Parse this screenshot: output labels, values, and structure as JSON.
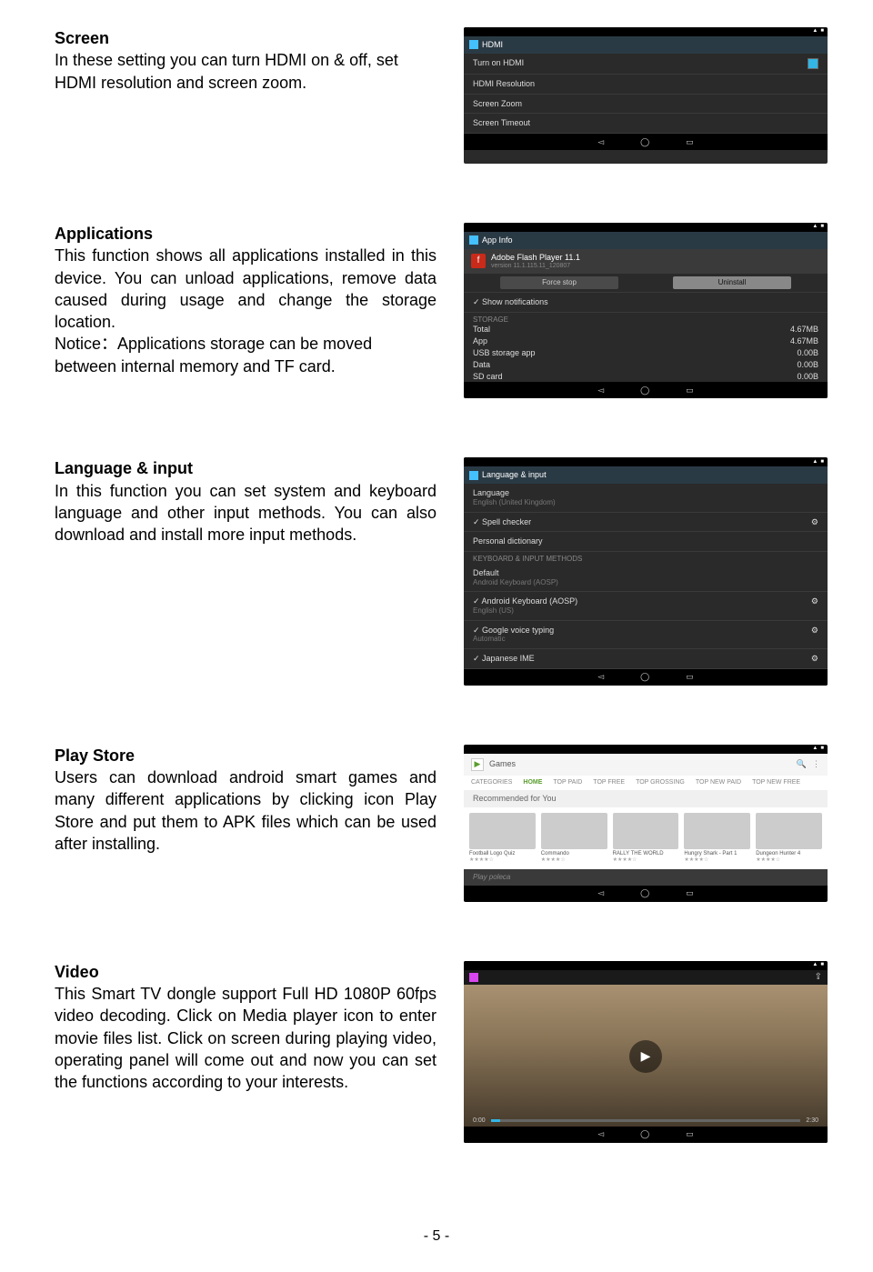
{
  "page_number": "- 5 -",
  "sections": {
    "screen": {
      "heading": "Screen",
      "body": "In these setting you can turn HDMI on & off, set HDMI resolution and screen zoom.",
      "thumb": {
        "title": "HDMI",
        "items": [
          "Turn on HDMI",
          "HDMI Resolution",
          "Screen Zoom",
          "Screen Timeout"
        ]
      }
    },
    "apps": {
      "heading": "Applications",
      "body1": "This function shows all applications installed in this device. You can unload applications, remove data caused during usage and change the storage location.",
      "body2": "Notice：Applications storage can be moved between internal memory and TF card.",
      "thumb": {
        "title": "App Info",
        "name": "Adobe Flash Player 11.1",
        "ver": "version 11.1.115.11_120807",
        "btn_force": "Force stop",
        "btn_uninstall": "Uninstall",
        "show_notif": "Show notifications",
        "storage_lbl": "STORAGE",
        "rows": [
          {
            "l": "Total",
            "v": "4.67MB"
          },
          {
            "l": "App",
            "v": "4.67MB"
          },
          {
            "l": "USB storage app",
            "v": "0.00B"
          },
          {
            "l": "Data",
            "v": "0.00B"
          },
          {
            "l": "SD card",
            "v": "0.00B"
          }
        ]
      }
    },
    "lang": {
      "heading": "Language & input",
      "body": "In this function you can set system and keyboard language and other input methods. You can also download and install more input methods.",
      "thumb": {
        "title": "Language & input",
        "lang_lbl": "Language",
        "lang_val": "English (United Kingdom)",
        "spell": "Spell checker",
        "personal": "Personal dictionary",
        "kim_lbl": "KEYBOARD & INPUT METHODS",
        "default_lbl": "Default",
        "default_val": "Android Keyboard (AOSP)",
        "items": [
          {
            "l": "Android Keyboard (AOSP)",
            "s": "English (US)"
          },
          {
            "l": "Google voice typing",
            "s": "Automatic"
          },
          {
            "l": "Japanese IME",
            "s": ""
          }
        ]
      }
    },
    "play": {
      "heading": "Play Store",
      "body": "Users can download android smart games and many different applications by clicking icon Play Store and put them to APK files which can be used after installing.",
      "thumb": {
        "tabs": [
          "CATEGORIES",
          "HOME",
          "TOP PAID",
          "TOP FREE",
          "TOP GROSSING",
          "TOP NEW PAID",
          "TOP NEW FREE"
        ],
        "rec": "Recommended for You",
        "cards": [
          {
            "n": "Football Logo Quiz",
            "s": "★★★★☆"
          },
          {
            "n": "Commando",
            "s": "★★★★☆"
          },
          {
            "n": "RALLY THE WORLD",
            "s": "★★★★☆"
          },
          {
            "n": "Hungry Shark - Part 1",
            "s": "★★★★☆"
          },
          {
            "n": "Dungeon Hunter 4",
            "s": "★★★★☆"
          }
        ],
        "foot": "Play poleca"
      }
    },
    "video": {
      "heading": "Video",
      "body": "This Smart TV dongle support Full HD 1080P 60fps video decoding. Click on Media player icon to enter movie files list. Click on screen during playing video, operating panel will come out and now you can set the functions according to your interests."
    }
  }
}
